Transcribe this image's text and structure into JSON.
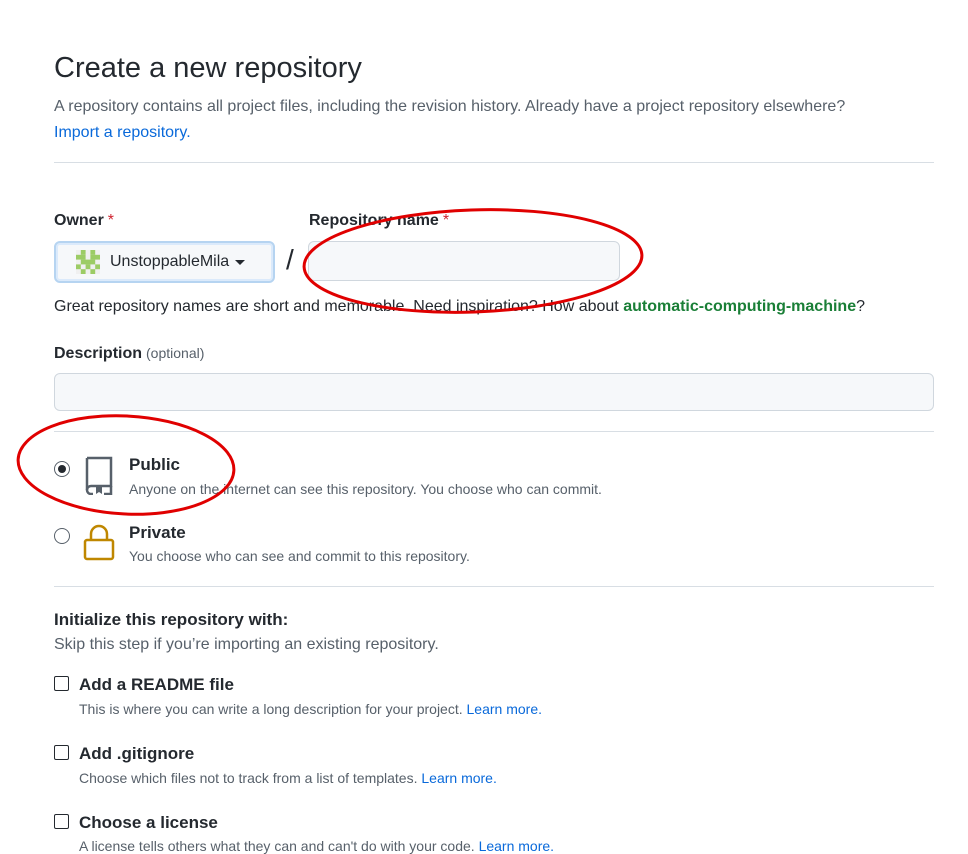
{
  "header": {
    "title": "Create a new repository",
    "subtitle": "A repository contains all project files, including the revision history. Already have a project repository elsewhere?",
    "import_link": "Import a repository."
  },
  "owner": {
    "label": "Owner",
    "required_mark": "*",
    "selected": "UnstoppableMila",
    "avatar_icon": "identicon-avatar"
  },
  "repo_name": {
    "label": "Repository name",
    "required_mark": "*",
    "value": "",
    "separator": "/"
  },
  "name_hint": {
    "text": "Great repository names are short and memorable. Need inspiration? How about",
    "suggestion": "automatic-computing-machine",
    "suffix": "?"
  },
  "description": {
    "label": "Description",
    "optional": "(optional)",
    "value": ""
  },
  "visibility": {
    "options": [
      {
        "title": "Public",
        "desc": "Anyone on the internet can see this repository. You choose who can commit.",
        "icon": "repo-book-icon",
        "checked": true
      },
      {
        "title": "Private",
        "desc": "You choose who can see and commit to this repository.",
        "icon": "lock-icon",
        "checked": false
      }
    ]
  },
  "init": {
    "title": "Initialize this repository with:",
    "subtitle": "Skip this step if you’re importing an existing repository.",
    "items": [
      {
        "title": "Add a README file",
        "desc": "This is where you can write a long description for your project.",
        "link": "Learn more.",
        "checked": false
      },
      {
        "title": "Add .gitignore",
        "desc": "Choose which files not to track from a list of templates.",
        "link": "Learn more.",
        "checked": false
      },
      {
        "title": "Choose a license",
        "desc": "A license tells others what they can and can't do with your code.",
        "link": "Learn more.",
        "checked": false
      }
    ]
  },
  "colors": {
    "link": "#0969da",
    "suggestion": "#1a7f37",
    "required": "#cf222e",
    "annotation": "#e00000",
    "lock_icon": "#bf8700"
  }
}
